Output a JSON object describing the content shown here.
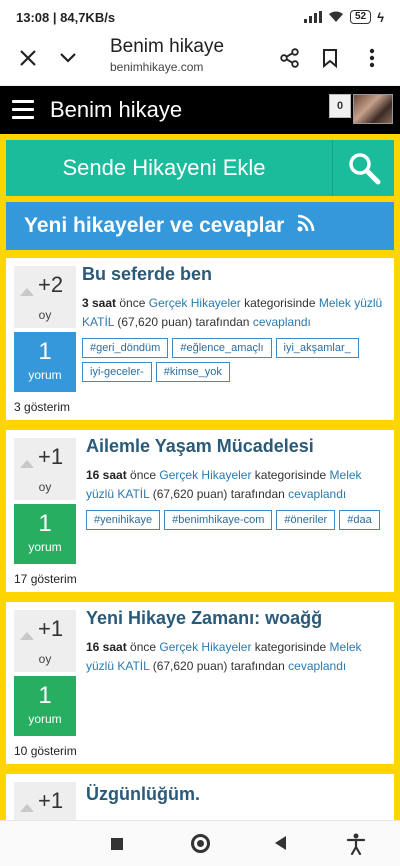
{
  "status": {
    "time": "13:08",
    "speed": "84,7KB/s",
    "battery": "52"
  },
  "browser": {
    "title": "Benim hikaye",
    "url": "benimhikaye.com"
  },
  "site": {
    "title": "Benim hikaye",
    "notif_count": "0"
  },
  "add_story_label": "Sende Hikayeni Ekle",
  "new_stories_label": "Yeni hikayeler ve cevaplar",
  "common": {
    "vote_unit": "oy",
    "answer_unit": "yorum",
    "preposition": "önce",
    "category_suffix": "kategorisinde",
    "points_suffix": "tarafından",
    "answered": "cevaplandı",
    "views_suffix": "gösterim"
  },
  "posts": [
    {
      "votes": "+2",
      "answers": "1",
      "title": "Bu seferde ben",
      "time": "3 saat",
      "category": "Gerçek Hikayeler",
      "user": "Melek yüzlü KATİL",
      "points": "(67,620 puan)",
      "tags": [
        "#geri_döndüm",
        "#eğlence_amaçlı",
        "iyi_akşamlar_",
        "iyi-geceler-",
        "#kimse_yok"
      ],
      "views": "3"
    },
    {
      "votes": "+1",
      "answers": "1",
      "title": "Ailemle Yaşam Mücadelesi",
      "time": "16 saat",
      "category": "Gerçek Hikayeler",
      "user": "Melek yüzlü KATİL",
      "points": "(67,620 puan)",
      "tags": [
        "#yenihikaye",
        "#benimhikaye-com",
        "#öneriler",
        "#daa"
      ],
      "views": "17"
    },
    {
      "votes": "+1",
      "answers": "1",
      "title": "Yeni Hikaye Zamanı: woağğ",
      "time": "16 saat",
      "category": "Gerçek Hikayeler",
      "user": "Melek yüzlü KATİL",
      "points": "(67,620 puan)",
      "tags": [],
      "views": "10"
    },
    {
      "votes": "+1",
      "title": "Üzgünlüğüm."
    }
  ]
}
